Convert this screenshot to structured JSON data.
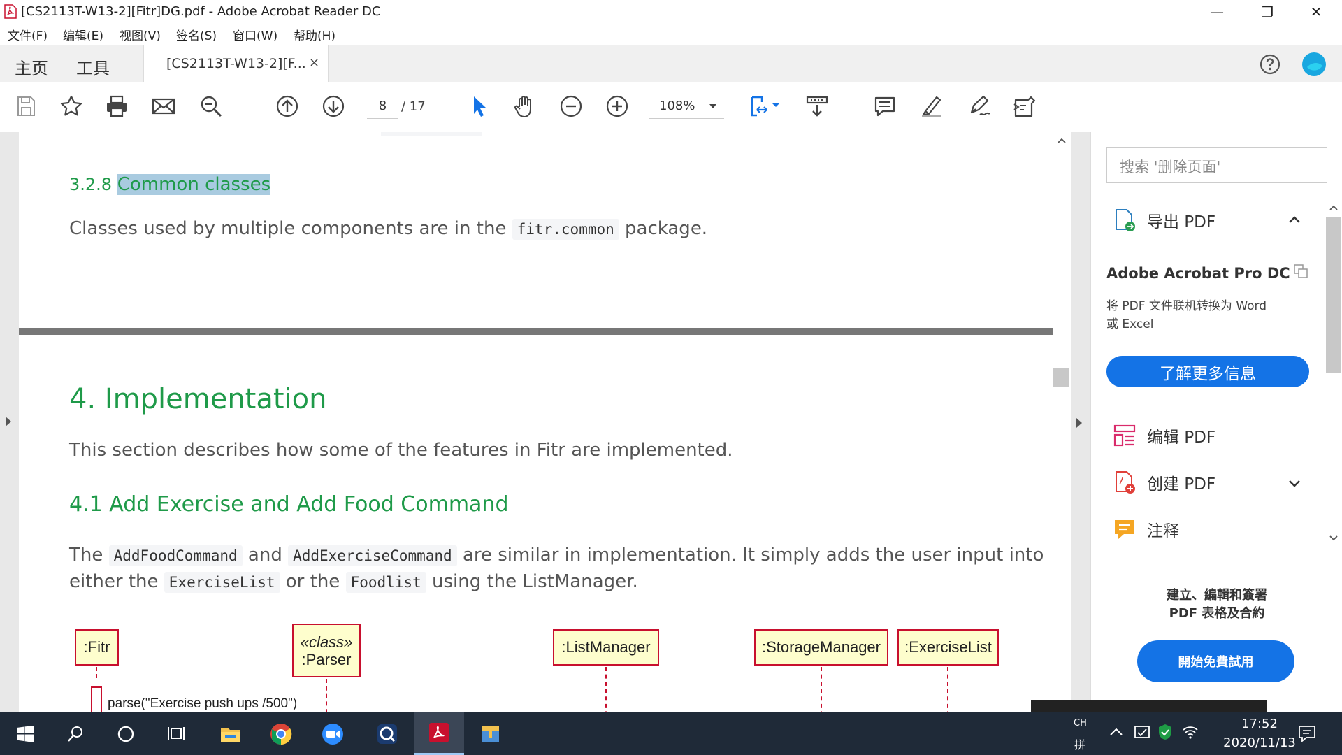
{
  "window": {
    "title": "[CS2113T-W13-2][Fitr]DG.pdf - Adobe Acrobat Reader DC",
    "minimize": "—",
    "maximize": "❐",
    "close": "✕"
  },
  "menu": [
    "文件(F)",
    "编辑(E)",
    "视图(V)",
    "签名(S)",
    "窗口(W)",
    "帮助(H)"
  ],
  "tabs": {
    "home": "主页",
    "tools": "工具",
    "document": "[CS2113T-W13-2][F...",
    "close": "×"
  },
  "toolbar": {
    "page_current": "8",
    "page_total": "/ 17",
    "zoom": "108%"
  },
  "document": {
    "section_number": "3.2.8",
    "section_title": "Common classes",
    "section_text_before": "Classes used by multiple components are in the",
    "section_code": "fitr.common",
    "section_text_after": "package.",
    "chapter_title": "4. Implementation",
    "chapter_text": "This section describes how some of the features in Fitr are implemented.",
    "subsection_title": "4.1 Add Exercise and Add Food Command",
    "para_the": "The",
    "para_code1": "AddFoodCommand",
    "para_and": "and",
    "para_code2": "AddExerciseCommand",
    "para_mid": "are similar in implementation. It simply adds the user input into",
    "para_either": "either the",
    "para_code3": "ExerciseList",
    "para_or": "or the",
    "para_code4": "Foodlist",
    "para_end": "using the ListManager.",
    "diagram": {
      "fitr": ":Fitr",
      "parser_stereotype": "«class»",
      "parser": ":Parser",
      "listmanager": ":ListManager",
      "storagemanager": ":StorageManager",
      "exerciselist": ":ExerciseList",
      "message": "parse(\"Exercise push ups /500\")"
    }
  },
  "right_pane": {
    "search_placeholder": "搜索 '删除页面'",
    "export_pdf": "导出 PDF",
    "promo_title": "Adobe Acrobat Pro DC",
    "promo_line1": "将 PDF 文件联机转换为 Word",
    "promo_line2": "或 Excel",
    "learn_more": "了解更多信息",
    "edit_pdf": "编辑 PDF",
    "create_pdf": "创建 PDF",
    "comment": "注释",
    "bottom_line1": "建立、編輯和簽署",
    "bottom_line2": "PDF 表格及合約",
    "trial_button": "開始免費試用"
  },
  "taskbar": {
    "lang": "CH",
    "ime": "拼",
    "time": "17:52",
    "date": "2020/11/13"
  },
  "colors": {
    "accent_blue": "#1473e6",
    "heading_green": "#1f9a49",
    "uml_border": "#c8102e",
    "uml_fill": "#fefecd",
    "taskbar": "#1f2a38"
  }
}
